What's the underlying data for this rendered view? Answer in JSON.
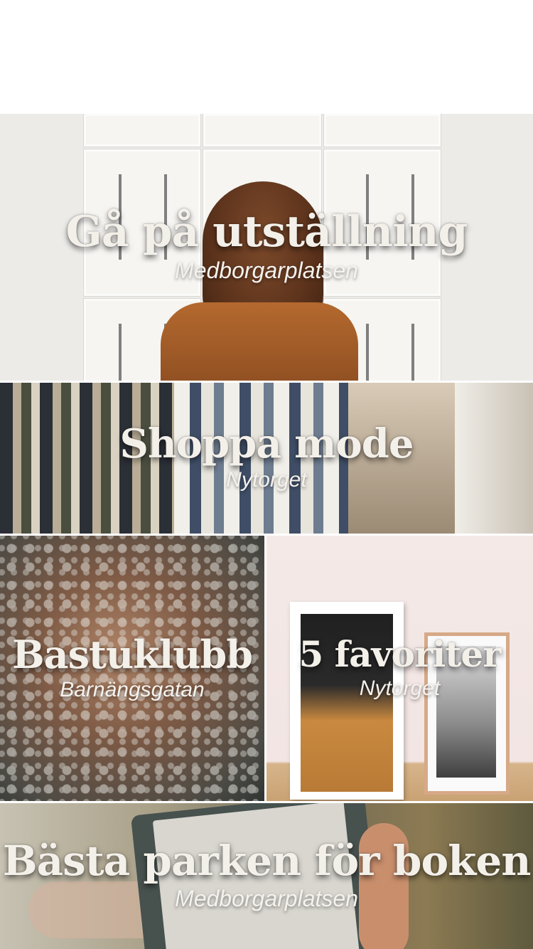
{
  "cards": [
    {
      "title": "Gå på utställning",
      "subtitle": "Medborgarplatsen"
    },
    {
      "title": "Shoppa mode",
      "subtitle": "Nytorget"
    },
    {
      "title": "Bastuklubb",
      "subtitle": "Barnängsgatan"
    },
    {
      "title": "5 favoriter",
      "subtitle": "Nytorget"
    },
    {
      "title": "Bästa parken för boken",
      "subtitle": "Medborgarplatsen"
    }
  ]
}
